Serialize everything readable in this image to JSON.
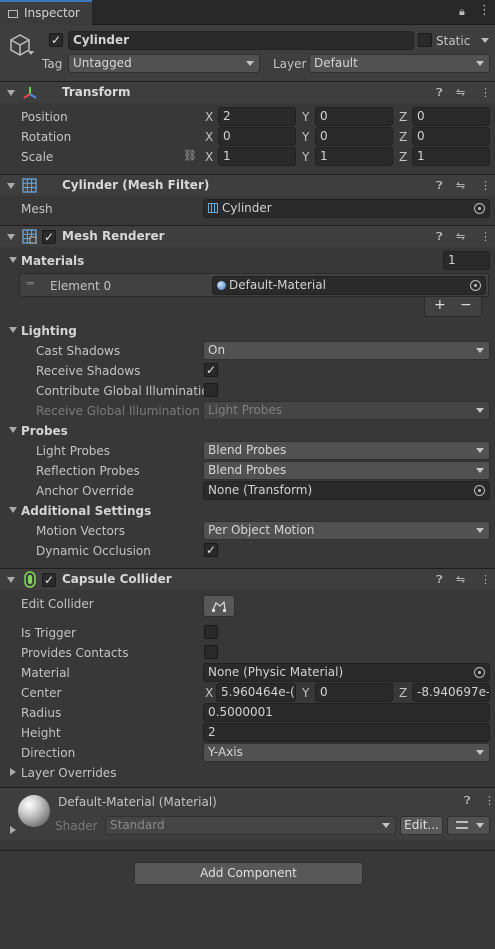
{
  "tab": {
    "label": "Inspector"
  },
  "gameobject": {
    "name": "Cylinder",
    "static_label": "Static",
    "tag_label": "Tag",
    "tag_value": "Untagged",
    "layer_label": "Layer",
    "layer_value": "Default"
  },
  "transform": {
    "title": "Transform",
    "position_label": "Position",
    "rotation_label": "Rotation",
    "scale_label": "Scale",
    "axes": [
      "X",
      "Y",
      "Z"
    ],
    "position": [
      "2",
      "0",
      "0"
    ],
    "rotation": [
      "0",
      "0",
      "0"
    ],
    "scale": [
      "1",
      "1",
      "1"
    ]
  },
  "mesh_filter": {
    "title": "Cylinder (Mesh Filter)",
    "mesh_label": "Mesh",
    "mesh_value": "Cylinder"
  },
  "mesh_renderer": {
    "title": "Mesh Renderer",
    "materials_label": "Materials",
    "materials_count": "1",
    "element_label": "Element 0",
    "element_value": "Default-Material",
    "plus": "+",
    "minus": "−",
    "lighting": {
      "header": "Lighting",
      "cast_shadows_label": "Cast Shadows",
      "cast_shadows_value": "On",
      "receive_shadows_label": "Receive Shadows",
      "contribute_gi_label": "Contribute Global Illumination",
      "receive_gi_label": "Receive Global Illumination",
      "receive_gi_value": "Light Probes"
    },
    "probes": {
      "header": "Probes",
      "light_probes_label": "Light Probes",
      "light_probes_value": "Blend Probes",
      "reflection_probes_label": "Reflection Probes",
      "reflection_probes_value": "Blend Probes",
      "anchor_label": "Anchor Override",
      "anchor_value": "None (Transform)"
    },
    "additional": {
      "header": "Additional Settings",
      "motion_vectors_label": "Motion Vectors",
      "motion_vectors_value": "Per Object Motion",
      "dynamic_occlusion_label": "Dynamic Occlusion"
    }
  },
  "capsule_collider": {
    "title": "Capsule Collider",
    "edit_label": "Edit Collider",
    "is_trigger_label": "Is Trigger",
    "provides_contacts_label": "Provides Contacts",
    "material_label": "Material",
    "material_value": "None (Physic Material)",
    "center_label": "Center",
    "center": [
      "5.960464e-(",
      "0",
      "-8.940697e-"
    ],
    "radius_label": "Radius",
    "radius_value": "0.5000001",
    "height_label": "Height",
    "height_value": "2",
    "direction_label": "Direction",
    "direction_value": "Y-Axis",
    "layer_overrides_label": "Layer Overrides"
  },
  "material": {
    "title": "Default-Material (Material)",
    "shader_label": "Shader",
    "shader_value": "Standard",
    "edit_button": "Edit..."
  },
  "add_component": "Add Component",
  "colors": {
    "accent": "#3a79bb",
    "panel": "#383838",
    "header": "#3e3e3e",
    "field": "#2a2a2a"
  }
}
